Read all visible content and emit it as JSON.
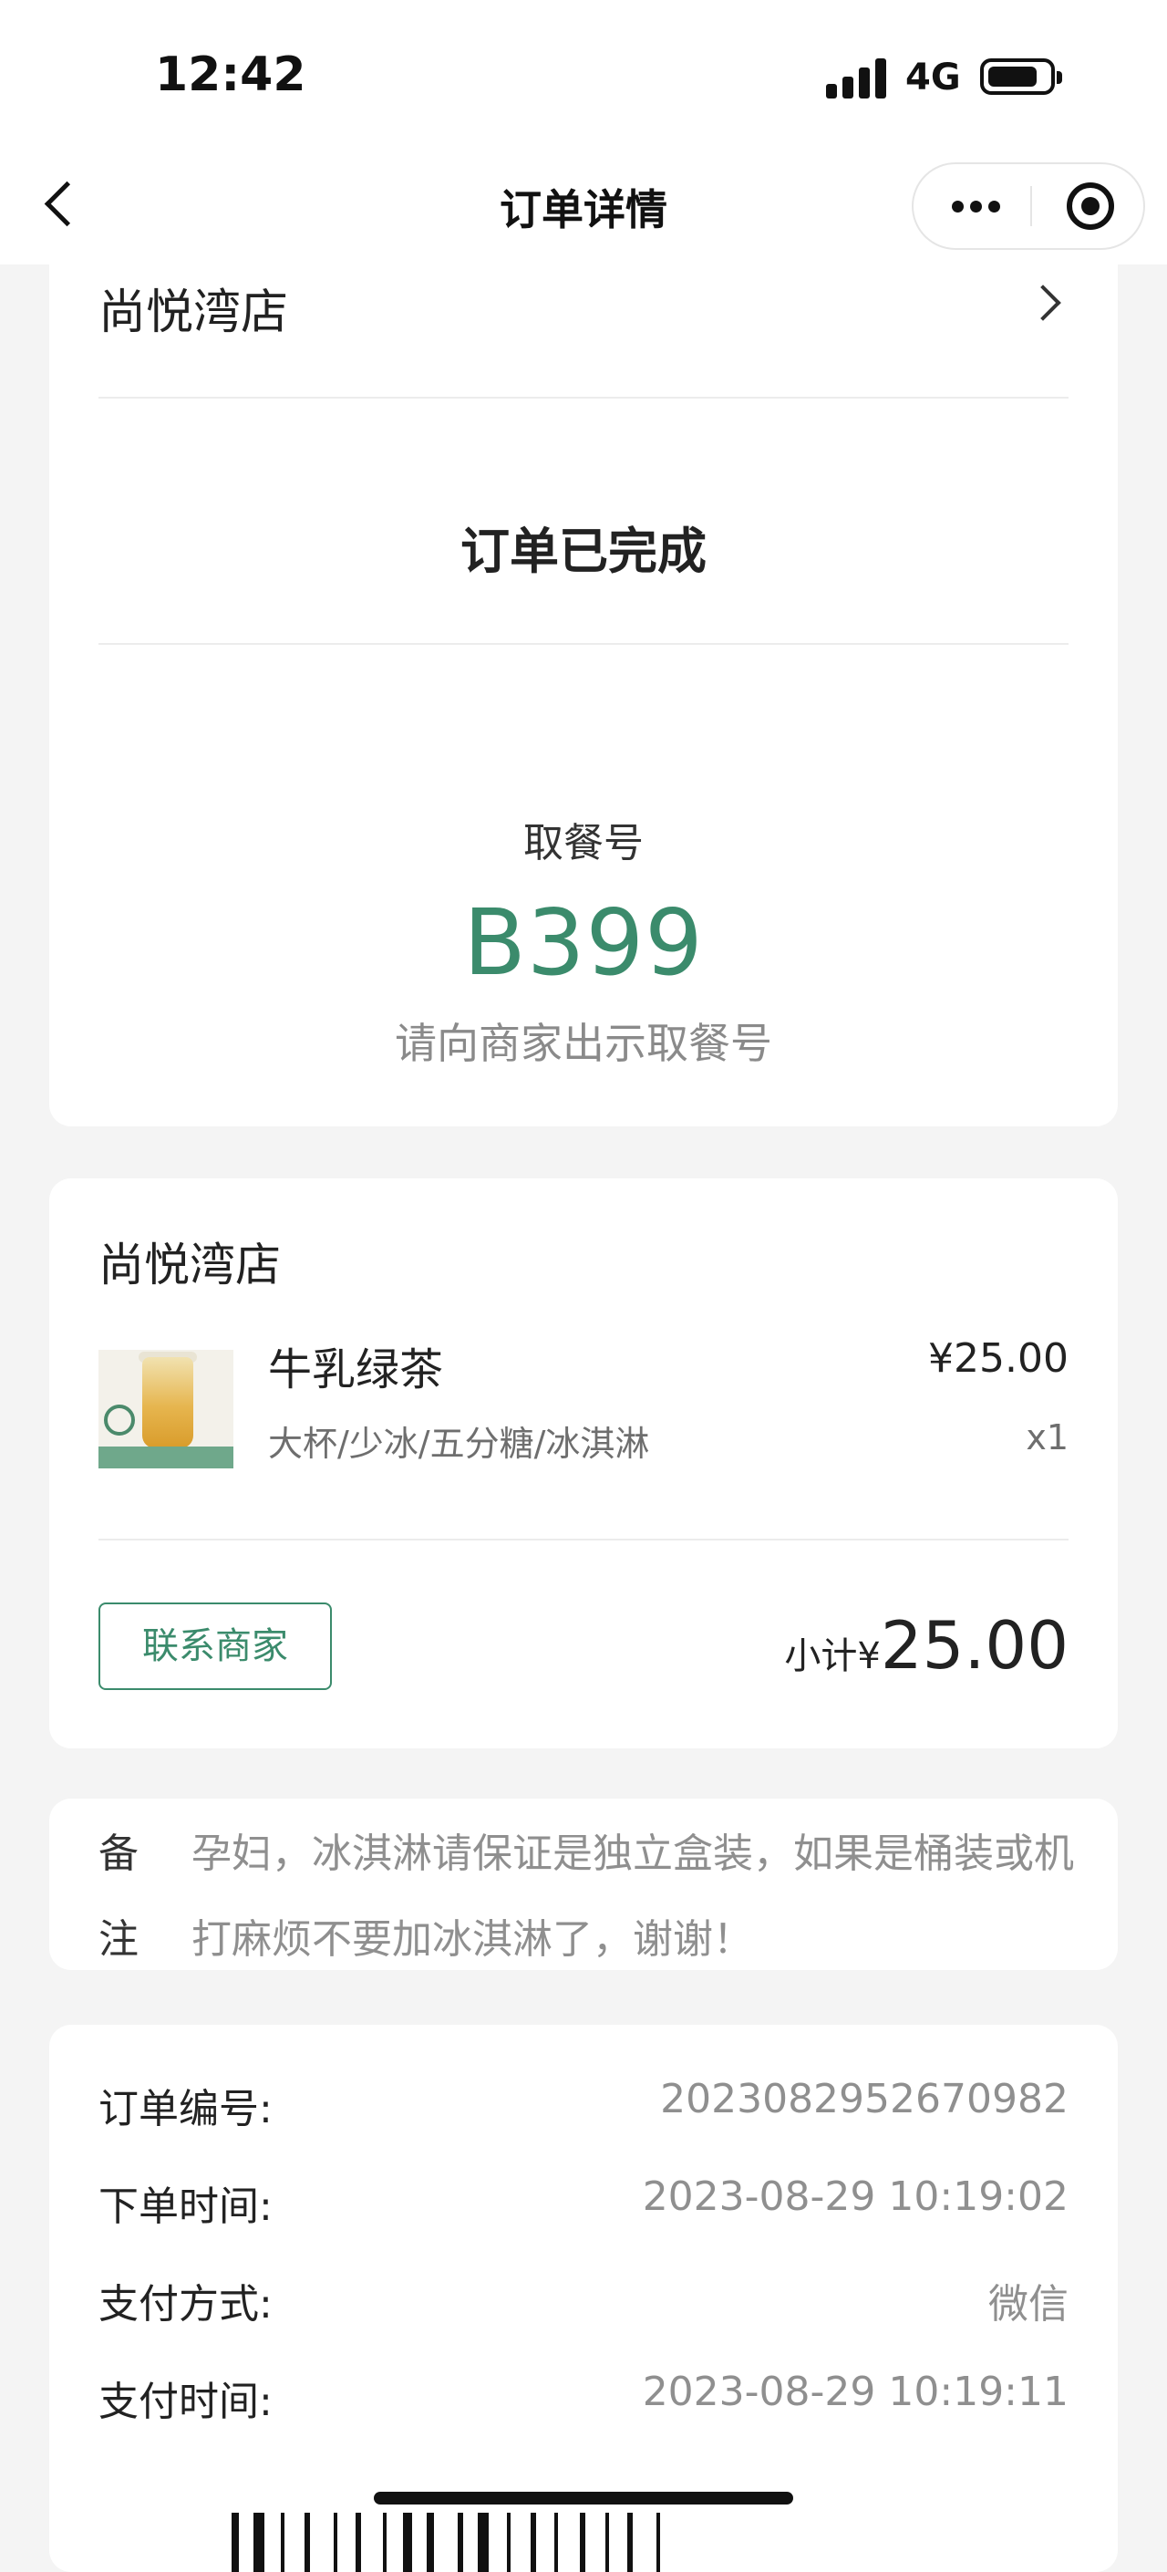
{
  "status_bar": {
    "time": "12:42",
    "network": "4G"
  },
  "nav": {
    "title": "订单详情"
  },
  "order_card": {
    "store_name": "尚悦湾店",
    "status": "订单已完成",
    "pickup_label": "取餐号",
    "pickup_number": "B399",
    "pickup_hint": "请向商家出示取餐号"
  },
  "items_card": {
    "store_name": "尚悦湾店",
    "items": [
      {
        "name": "牛乳绿茶",
        "price": "¥25.00",
        "spec": "大杯/少冰/五分糖/冰淇淋",
        "qty": "x1"
      }
    ],
    "contact_label": "联系商家",
    "subtotal_label": "小计¥",
    "subtotal_amount": "25.00"
  },
  "remark": {
    "label_line1": "备",
    "label_line2": "注",
    "text": "孕妇，冰淇淋请保证是独立盒装，如果是桶装或机打麻烦不要加冰淇淋了，谢谢！"
  },
  "order_info": {
    "rows": [
      {
        "label": "订单编号:",
        "value": "2023082952670982"
      },
      {
        "label": "下单时间:",
        "value": "2023-08-29 10:19:02"
      },
      {
        "label": "支付方式:",
        "value": "微信"
      },
      {
        "label": "支付时间:",
        "value": "2023-08-29 10:19:11"
      }
    ]
  },
  "colors": {
    "accent": "#3b8b6c",
    "background": "#f4f4f4",
    "card": "#ffffff"
  },
  "icons": [
    "back-icon",
    "more-icon",
    "target-icon",
    "chevron-right-icon",
    "barcode-icon"
  ]
}
